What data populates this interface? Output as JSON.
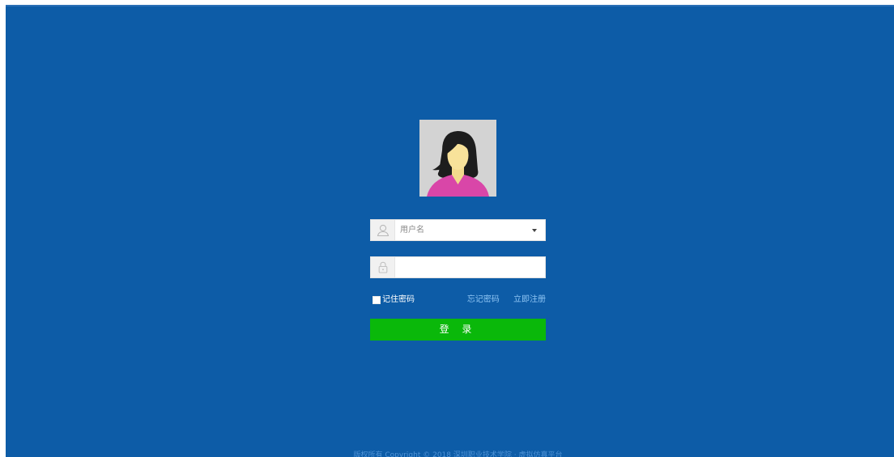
{
  "login_form": {
    "username_placeholder": "用户名",
    "password_value": "",
    "remember_label": "记住密码",
    "forgot_label": "忘记密码",
    "register_label": "立即注册",
    "login_label": "登 录"
  },
  "footer": {
    "text": "版权所有 Copyright © 2018 深圳职业技术学院 · 虚拟仿真平台"
  },
  "colors": {
    "background": "#0d5ca7",
    "login_button": "#0ab80a",
    "link": "#8ec5f4"
  },
  "icons": [
    "avatar-image",
    "user-icon",
    "lock-icon",
    "dropdown-caret-icon"
  ]
}
